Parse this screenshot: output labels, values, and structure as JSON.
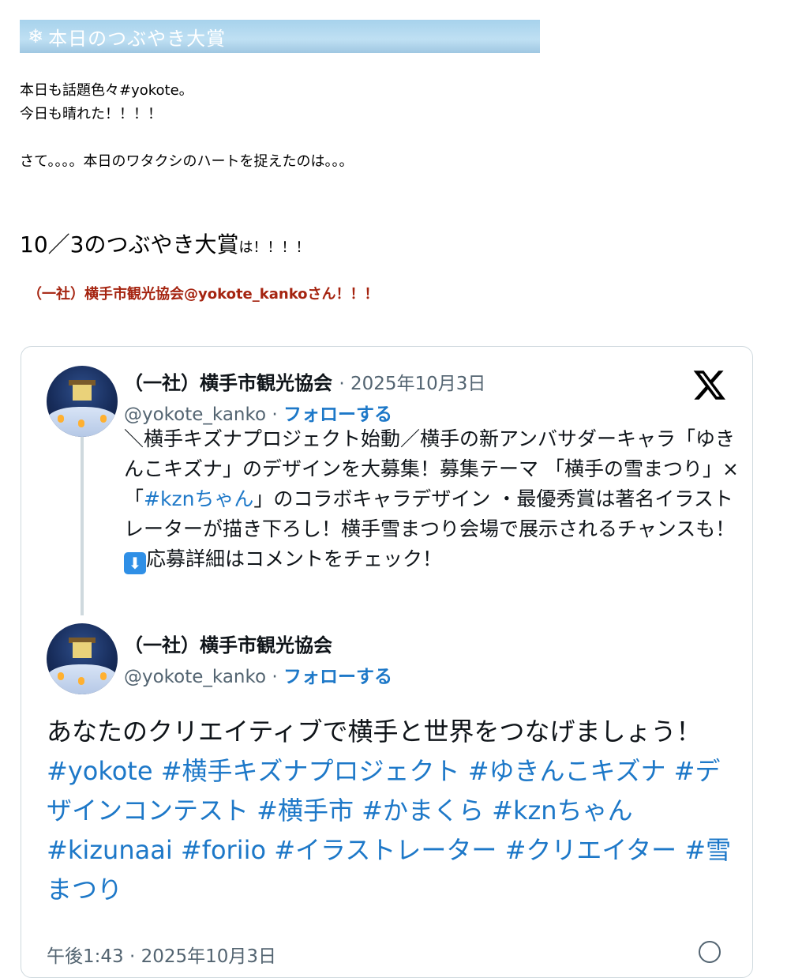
{
  "header": {
    "icon": "snowflake-icon",
    "title": "本日のつぶやき大賞"
  },
  "intro": {
    "line1": "本日も話題色々#yokote。",
    "line2": "今日も晴れた！！！！",
    "line3": "さて。。。。本日のワタクシのハートを捉えたのは。。。"
  },
  "award": {
    "main": "10／3のつぶやき大賞",
    "suffix": "は！！！！",
    "winner": "（一社）横手市観光協会@yokote_kankoさん！！！"
  },
  "embed": {
    "first": {
      "name": "（一社）横手市観光協会",
      "date": "· 2025年10月3日",
      "handle": "@yokote_kanko ·",
      "follow": "フォローする",
      "text_a": "＼横手キズナプロジェクト始動／横手の新アンバサダーキャラ「ゆきんこキズナ」のデザインを大募集！募集テーマ 「横手の雪まつり」×「",
      "hashtag": "#kznちゃん",
      "text_b": "」のコラボキャラデザイン ・最優秀賞は著名イラストレーターが描き下ろし！横手雪まつり会場で展示されるチャンスも！",
      "down_emoji": "⬇",
      "text_c": "応募詳細はコメントをチェック！"
    },
    "second": {
      "name": "（一社）横手市観光協会",
      "handle": "@yokote_kanko ·",
      "follow": "フォローする",
      "text": "あなたのクリエイティブで横手と世界をつなげましょう！",
      "hashtags": "#yokote #横手キズナプロジェクト #ゆきんこキズナ #デザインコンテスト #横手市 #かまくら #kznちゃん #kizunaai #foriio #イラストレーター #クリエイター #雪まつり"
    },
    "footer_time": "午後1:43 · 2025年10月3日"
  },
  "colors": {
    "header_bar": "#a7d2ec",
    "winner_text": "#a52410",
    "link": "#1d78c8",
    "muted": "#536471"
  }
}
